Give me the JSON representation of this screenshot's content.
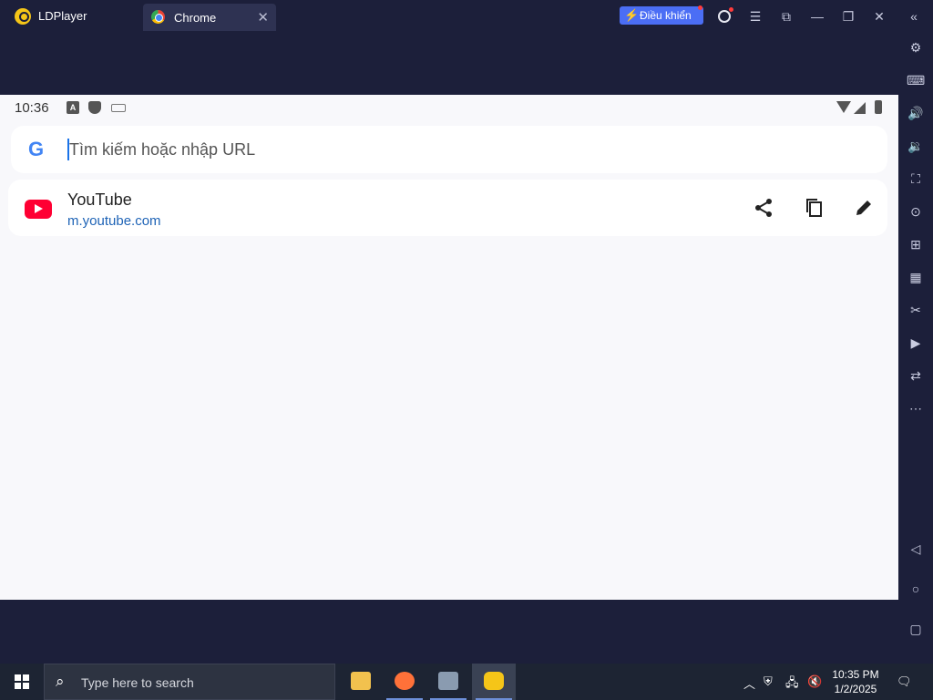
{
  "titlebar": {
    "app_name": "LDPlayer",
    "tab_label": "Chrome",
    "tab_close": "✕",
    "control_button": "Điều khiển"
  },
  "android": {
    "status_time": "10:36",
    "search_placeholder": "Tìm kiếm hoặc nhập URL",
    "suggestion": {
      "title": "YouTube",
      "url": "m.youtube.com"
    }
  },
  "taskbar": {
    "search_placeholder": "Type here to search",
    "time": "10:35 PM",
    "date": "1/2/2025"
  },
  "colors": {
    "frame": "#1c1f3a",
    "control_button": "#4b6ef5",
    "youtube": "#ff0033",
    "link": "#1e63b6",
    "taskbar": "#1d2433"
  },
  "icons": {
    "titlebar": [
      "ldplayer-logo-icon",
      "chrome-icon",
      "close-tab-icon",
      "lightning-icon",
      "user-icon",
      "menu-icon",
      "screen-icon",
      "minimize-icon",
      "restore-icon",
      "close-icon",
      "collapse-icon"
    ],
    "sidebar": [
      "settings-icon",
      "keyboard-icon",
      "volume-up-icon",
      "volume-down-icon",
      "fullscreen-icon",
      "location-icon",
      "multi-instance-icon",
      "apk-install-icon",
      "screenshot-icon",
      "record-icon",
      "sync-icon",
      "more-icon",
      "back-icon",
      "home-icon",
      "recent-apps-icon"
    ],
    "suggestion_actions": [
      "share-icon",
      "copy-icon",
      "edit-icon"
    ]
  }
}
